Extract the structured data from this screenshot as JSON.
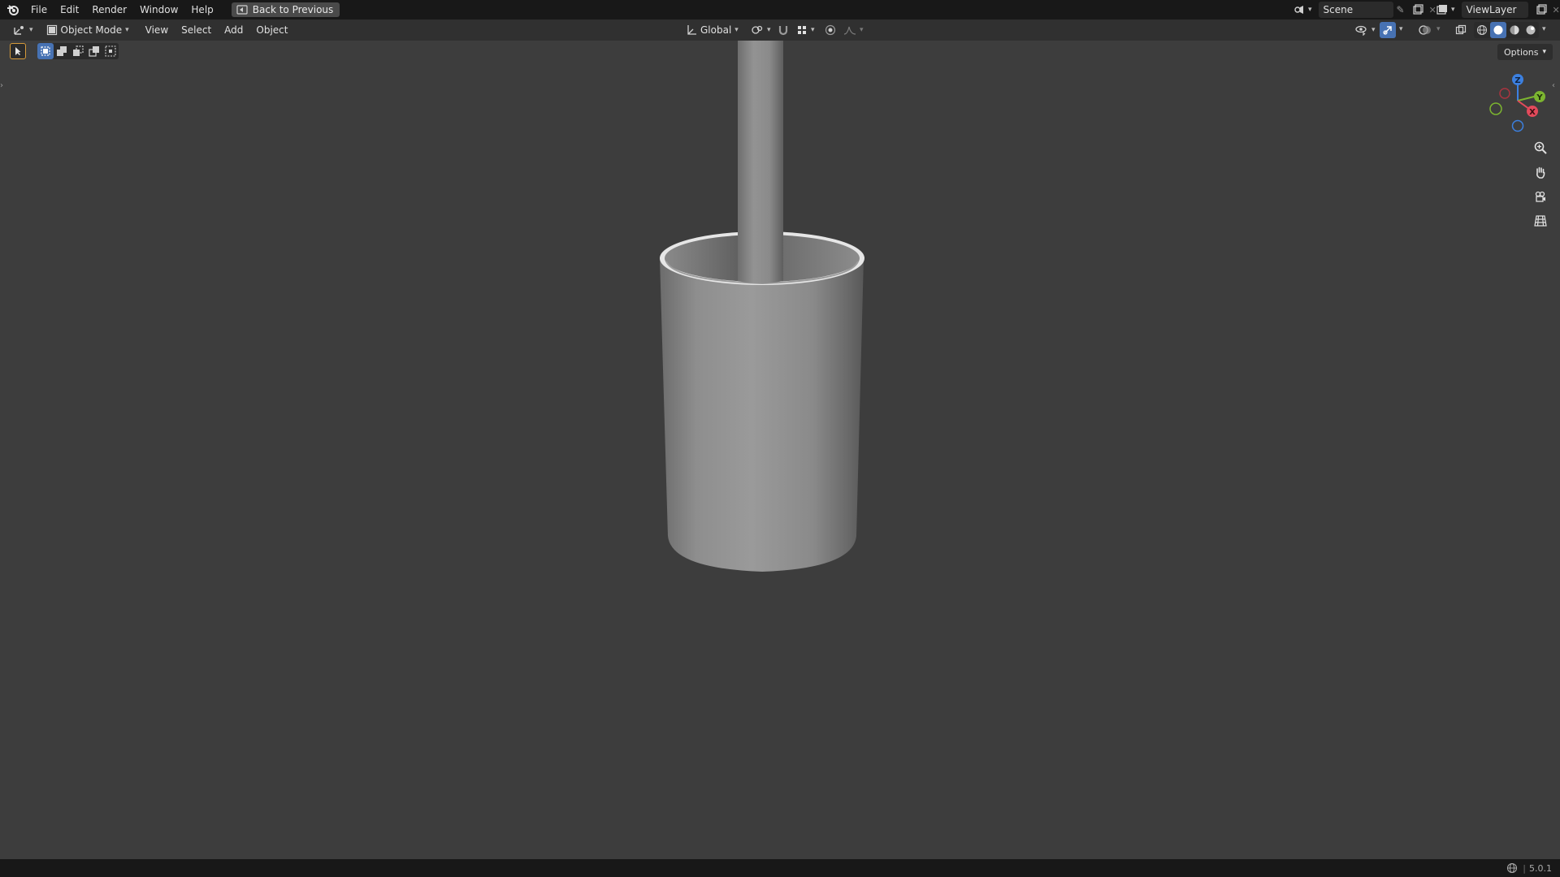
{
  "menu": {
    "items": [
      "File",
      "Edit",
      "Render",
      "Window",
      "Help"
    ],
    "back_button": "Back to Previous"
  },
  "scene": {
    "name": "Scene"
  },
  "view_layer": {
    "name": "ViewLayer"
  },
  "header": {
    "mode": "Object Mode",
    "menus": [
      "View",
      "Select",
      "Add",
      "Object"
    ],
    "orientation": "Global"
  },
  "viewport": {
    "options_label": "Options",
    "gizmo": {
      "z": "Z",
      "y": "Y",
      "x": "X"
    }
  },
  "status": {
    "version": "5.0.1"
  },
  "colors": {
    "axis_x": "#e34a5b",
    "axis_y": "#7cb530",
    "axis_z": "#3c80e0",
    "accent": "#4772b3"
  }
}
